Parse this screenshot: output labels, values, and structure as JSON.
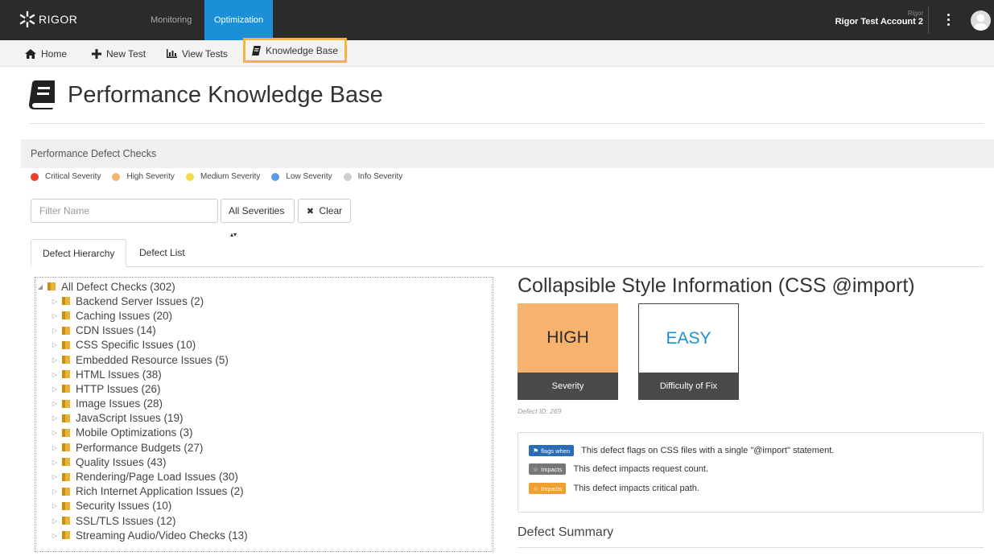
{
  "app": {
    "logo_text": "RIGOR",
    "top_tabs": [
      {
        "label": "Monitoring",
        "active": false
      },
      {
        "label": "Optimization",
        "active": true
      }
    ],
    "account_org": "Rigor",
    "account_name": "Rigor Test Account 2"
  },
  "subnav": {
    "home": "Home",
    "new_test": "New Test",
    "view_tests": "View Tests",
    "knowledge_base": "Knowledge Base"
  },
  "page": {
    "title": "Performance Knowledge Base"
  },
  "panel": {
    "title": "Performance Defect Checks",
    "legend": [
      {
        "label": "Critical Severity",
        "color": "#e8412f"
      },
      {
        "label": "High Severity",
        "color": "#f7b26e"
      },
      {
        "label": "Medium Severity",
        "color": "#f5d94a"
      },
      {
        "label": "Low Severity",
        "color": "#5a9be6"
      },
      {
        "label": "Info Severity",
        "color": "#cfcfcf"
      }
    ],
    "filter_placeholder": "Filter Name",
    "severity_select": "All Severities",
    "clear_label": "Clear",
    "tabs": [
      {
        "label": "Defect Hierarchy",
        "active": true
      },
      {
        "label": "Defect List",
        "active": false
      }
    ]
  },
  "tree": {
    "root": "All Defect Checks (302)",
    "children": [
      "Backend Server Issues (2)",
      "Caching Issues (20)",
      "CDN Issues (14)",
      "CSS Specific Issues (10)",
      "Embedded Resource Issues (5)",
      "HTML Issues (38)",
      "HTTP Issues (26)",
      "Image Issues (28)",
      "JavaScript Issues (19)",
      "Mobile Optimizations (3)",
      "Performance Budgets (27)",
      "Quality Issues (43)",
      "Rendering/Page Load Issues (30)",
      "Rich Internet Application Issues (2)",
      "Security Issues (10)",
      "SSL/TLS Issues (12)",
      "Streaming Audio/Video Checks (13)"
    ]
  },
  "detail": {
    "title": "Collapsible Style Information (CSS @import)",
    "severity_value": "HIGH",
    "severity_label": "Severity",
    "difficulty_value": "EASY",
    "difficulty_label": "Difficulty of Fix",
    "defect_id": "Defect ID: 269",
    "rows": [
      {
        "badge": "flags when",
        "badge_color": "#2a6db5",
        "text": "This defect flags on CSS files with a single \"@import\" statement."
      },
      {
        "badge": "Impacts",
        "badge_color": "#777777",
        "text": "This defect impacts request count."
      },
      {
        "badge": "Impacts",
        "badge_color": "#f0a033",
        "text": "This defect impacts critical path."
      }
    ],
    "summary_heading": "Defect Summary"
  }
}
